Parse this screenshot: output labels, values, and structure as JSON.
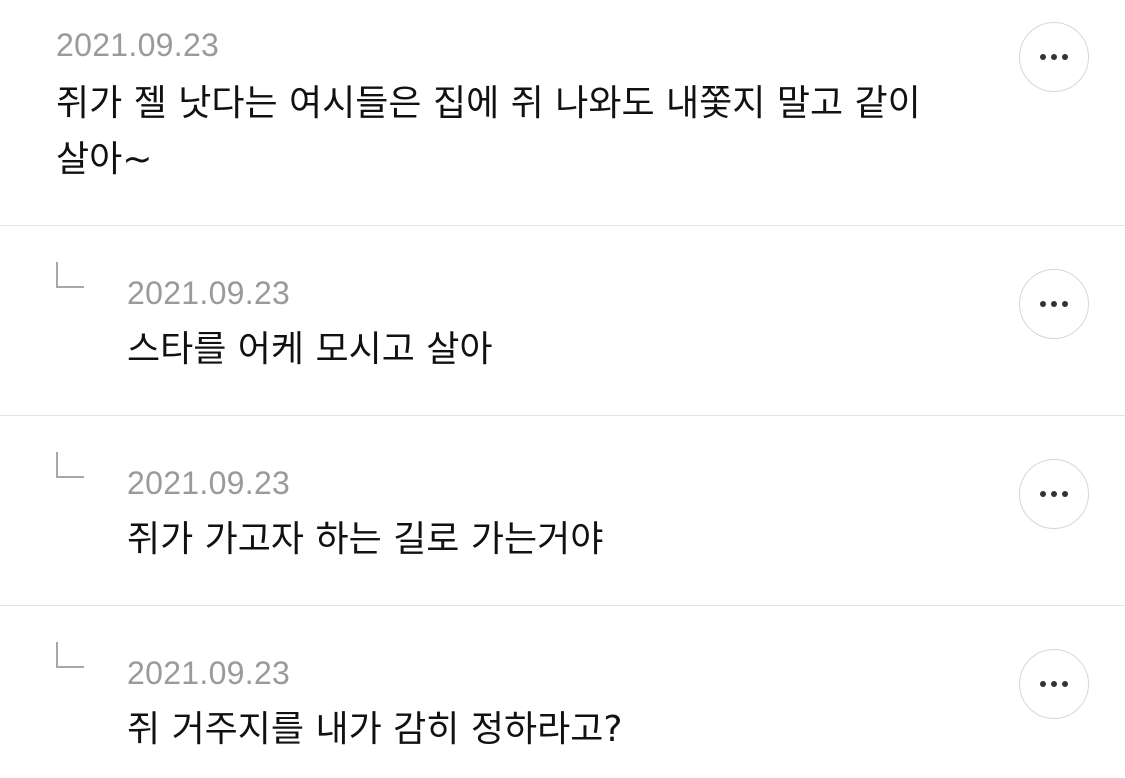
{
  "comments": [
    {
      "date": "2021.09.23",
      "text": "쥐가 젤 낫다는 여시들은 집에 쥐 나와도 내쫓지 말고 같이 살아~",
      "is_reply": false,
      "more_icon": "more-horizontal-icon"
    },
    {
      "date": "2021.09.23",
      "text": "스타를 어케 모시고 살아",
      "is_reply": true,
      "reply_icon": "reply-arrow-icon",
      "more_icon": "more-horizontal-icon"
    },
    {
      "date": "2021.09.23",
      "text": "쥐가 가고자 하는 길로 가는거야",
      "is_reply": true,
      "reply_icon": "reply-arrow-icon",
      "more_icon": "more-horizontal-icon"
    },
    {
      "date": "2021.09.23",
      "text": "쥐 거주지를 내가 감히 정하라고?",
      "is_reply": true,
      "reply_icon": "reply-arrow-icon",
      "more_icon": "more-horizontal-icon"
    }
  ],
  "colors": {
    "date": "#9a9a9a",
    "text": "#111111",
    "divider": "#e3e3e3",
    "button_border": "#d7d7d7"
  }
}
